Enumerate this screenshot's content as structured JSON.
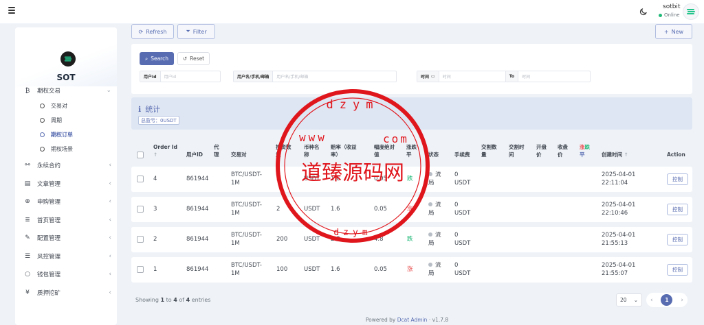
{
  "topbar": {
    "user_name": "sotbit",
    "user_status": "Online"
  },
  "sidebar": {
    "brand_name": "SOT",
    "open_menu_label": "期权交易",
    "submenu": [
      {
        "label": "交易对",
        "active": false
      },
      {
        "label": "周期",
        "active": false
      },
      {
        "label": "期权订单",
        "active": true
      },
      {
        "label": "期权场景",
        "active": false
      }
    ],
    "menu": [
      {
        "label": "永续合约",
        "icon": "link-icon"
      },
      {
        "label": "文章管理",
        "icon": "article-icon"
      },
      {
        "label": "申购管理",
        "icon": "globe-icon"
      },
      {
        "label": "首页管理",
        "icon": "list-icon"
      },
      {
        "label": "配置管理",
        "icon": "wrench-icon"
      },
      {
        "label": "风控管理",
        "icon": "chart-icon"
      },
      {
        "label": "钱包管理",
        "icon": "circle-icon"
      },
      {
        "label": "质押挖矿",
        "icon": "yen-icon"
      }
    ]
  },
  "toolbar": {
    "refresh_label": "Refresh",
    "filter_label": "Filter",
    "new_label": "New"
  },
  "filter": {
    "search_label": "Search",
    "reset_label": "Reset",
    "user_id_label": "用户Id",
    "user_id_placeholder": "用户Id",
    "user_name_label": "用户名/手机/邮箱",
    "user_name_placeholder": "用户名/手机/邮箱",
    "time_label": "时间",
    "time_from_placeholder": "时间",
    "time_to_label": "To",
    "time_to_placeholder": "时间"
  },
  "stats": {
    "title": "统计",
    "badge": "总盈亏：0USDT"
  },
  "table": {
    "headers": {
      "order_id": "Order Id",
      "user_id": "用户ID",
      "agent": "代理",
      "pair": "交易对",
      "amount": "投资数量",
      "currency": "币种名称",
      "odds": "赔率（收益率）",
      "range": "幅度绝对值",
      "updown": "涨跌平",
      "status": "状态",
      "fee": "手续费",
      "trade_qty": "交割数量",
      "trade_time": "交割时间",
      "open_price": "开盘价",
      "close_price": "收盘价",
      "result_up": "涨",
      "result_down": "跌",
      "result_flat": "平",
      "created": "创建时间",
      "action": "Action"
    },
    "rows": [
      {
        "id": "4",
        "user": "861944",
        "pair": "BTC/USDT-1M",
        "amount": "5",
        "currency": "USDT",
        "odds": "1.6",
        "range": "0.05",
        "updown": "跌",
        "updown_color": "#21b978",
        "status": "流局",
        "fee": "0",
        "fee_unit": "USDT",
        "date": "2025-04-01",
        "time": "22:11:04",
        "action": "控制"
      },
      {
        "id": "3",
        "user": "861944",
        "pair": "BTC/USDT-1M",
        "amount": "2",
        "currency": "USDT",
        "odds": "1.6",
        "range": "0.05",
        "updown": "涨",
        "updown_color": "#ea5455",
        "status": "流局",
        "fee": "0",
        "fee_unit": "USDT",
        "date": "2025-04-01",
        "time": "22:10:46",
        "action": "控制"
      },
      {
        "id": "2",
        "user": "861944",
        "pair": "BTC/USDT-1M",
        "amount": "200",
        "currency": "USDT",
        "odds": "2.8",
        "range": "4.8",
        "updown": "跌",
        "updown_color": "#21b978",
        "status": "流局",
        "fee": "0",
        "fee_unit": "USDT",
        "date": "2025-04-01",
        "time": "21:55:13",
        "action": "控制"
      },
      {
        "id": "1",
        "user": "861944",
        "pair": "BTC/USDT-1M",
        "amount": "100",
        "currency": "USDT",
        "odds": "1.6",
        "range": "0.05",
        "updown": "涨",
        "updown_color": "#ea5455",
        "status": "流局",
        "fee": "0",
        "fee_unit": "USDT",
        "date": "2025-04-01",
        "time": "21:55:07",
        "action": "控制"
      }
    ]
  },
  "pagination": {
    "showing_prefix": "Showing",
    "from": "1",
    "to_word": "to",
    "to": "4",
    "of_word": "of",
    "total": "4",
    "suffix": "entries",
    "per_page": "20",
    "current_page": "1"
  },
  "footer": {
    "powered_by": "Powered by",
    "link": "Dcat Admin",
    "version": "v1.7.8"
  },
  "watermark": {
    "text": "道臻源码网",
    "ring_top": "dzym",
    "ring_www": "www",
    "ring_com": "com",
    "ring_bottom": "dzym"
  },
  "colors": {
    "primary": "#586cb1",
    "up": "#ea5455",
    "down": "#21b978",
    "stamp": "#e0161d"
  }
}
